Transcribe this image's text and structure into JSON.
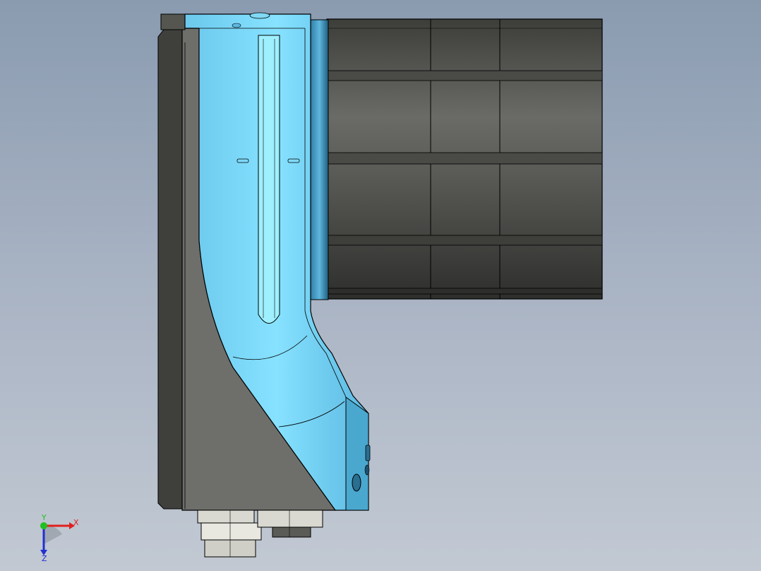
{
  "viewport": {
    "background_top": "#8a9bb0",
    "background_bottom": "#c2c9d3"
  },
  "model": {
    "bracket_color": "#7fd9f5",
    "bracket_shadow_color": "#4aa8cf",
    "body_color": "#6e6f6b",
    "motor_color": "#4b4c48",
    "fastener_color": "#d9d9d2",
    "edge_color": "#000000"
  },
  "triad": {
    "x_label": "X",
    "y_label": "Y",
    "z_label": "Z",
    "x_color": "#e02020",
    "y_color": "#20c020",
    "z_color": "#2030d0"
  }
}
